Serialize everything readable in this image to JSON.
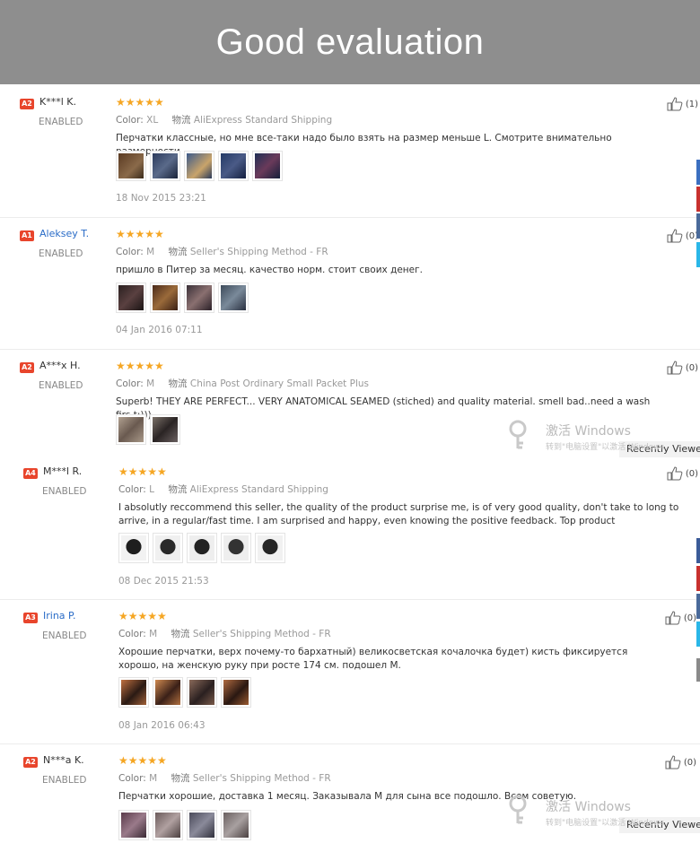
{
  "banner": {
    "title": "Good evaluation"
  },
  "labels": {
    "color": "Color:",
    "shipping_cn": "物流"
  },
  "reviews": [
    {
      "level": "A2",
      "name": "K***l K.",
      "status": "ENABLED",
      "stars": "★★★★★",
      "color": "XL",
      "shipping": "AliExpress Standard Shipping",
      "text": "Перчатки классные, но мне все-таки надо было взять на размер меньше L. Смотрите внимательно размерности",
      "date": "18 Nov 2015 23:21",
      "helpful": "(1)",
      "photo_colors": [
        "#6b4a2e",
        "#2b3a5c",
        "#3c5a8a",
        "#243a66",
        "#1f2f55"
      ]
    },
    {
      "level": "A1",
      "name": "Aleksey T.",
      "status": "ENABLED",
      "stars": "★★★★★",
      "color": "M",
      "shipping": "Seller's Shipping Method - FR",
      "text": "пришло в Питер за месяц. качество норм. стоит своих денег.",
      "date": "04 Jan 2016 07:11",
      "helpful": "(0)",
      "photo_colors": [
        "#3a3030",
        "#5a3a2a",
        "#4a4048",
        "#3d4a5a"
      ]
    },
    {
      "level": "A2",
      "name": "A***x H.",
      "status": "ENABLED",
      "stars": "★★★★★",
      "color": "M",
      "shipping": "China Post Ordinary Small Packet Plus",
      "text": "Superb! THEY ARE PERFECT... VERY ANATOMICAL SEAMED (stiched) and quality material. smell bad..need a wash firs t:)))",
      "date": "",
      "helpful": "(0)",
      "photo_colors": [
        "#8a7a70",
        "#4a4040"
      ]
    },
    {
      "level": "A4",
      "name": "M***l R.",
      "status": "ENABLED",
      "stars": "★★★★★",
      "color": "L",
      "shipping": "AliExpress Standard Shipping",
      "text": "I absolutly reccommend this seller, the quality of the product surprise me, is of very good quality, don't take to long to arrive, in a regular/fast time. I am surprised and happy, even knowing the positive feedback. Top product",
      "date": "08 Dec 2015 21:53",
      "helpful": "(0)",
      "photo_colors": [
        "#2a2a2a",
        "#333333",
        "#2e2e2e",
        "#3a3a3a",
        "#2c2c2c"
      ]
    },
    {
      "level": "A3",
      "name": "Irina P.",
      "status": "ENABLED",
      "stars": "★★★★★",
      "color": "M",
      "shipping": "Seller's Shipping Method - FR",
      "text": "Хорошие перчатки, верх почему-то бархатный) великосветская кочалочка будет) кисть фиксируется хорошо, на женскую руку при росте 174 см. подошел М.",
      "date": "08 Jan 2016 06:43",
      "helpful": "(0)",
      "photo_colors": [
        "#7a4a2a",
        "#8a5030",
        "#6a4a3a",
        "#7a4030"
      ]
    },
    {
      "level": "A2",
      "name": "N***a K.",
      "status": "ENABLED",
      "stars": "★★★★★",
      "color": "M",
      "shipping": "Seller's Shipping Method - FR",
      "text": "Перчатки хорошие, доставка 1 месяц. Заказывала М для сына все подошло. Всем советую.",
      "date": "",
      "helpful": "(0)",
      "photo_colors": [
        "#5a3a4a",
        "#6a5a5a",
        "#4a4a5a",
        "#6a6060"
      ]
    }
  ],
  "side": {
    "recently_viewed": "Recently Viewe"
  },
  "watermark": {
    "line1": "激活 Windows",
    "line2": "转到\"电脑设置\"以激活 Windows"
  },
  "colors": {
    "level_badge": "#e8452c",
    "stars": "#f5a623",
    "link": "#2a6cc7",
    "banner": "#8e8e8e"
  }
}
